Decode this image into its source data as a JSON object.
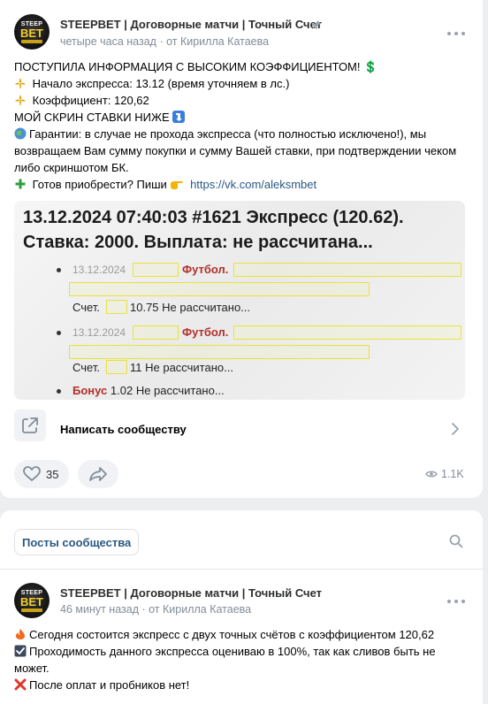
{
  "post1": {
    "avatar": {
      "top": "STEEP",
      "mid": "BET"
    },
    "author": "STEEPBET | Договорные матчи | Точный Счет",
    "time": "четыре часа назад",
    "from": "от Кирилла Катаева",
    "lines": {
      "l1": "ПОСТУПИЛА ИНФОРМАЦИЯ С ВЫСОКИМ КОЭФФИЦИЕНТОМ!",
      "l1_emoji": "💲",
      "l2": "Начало экспресса: 13.12 (время уточняем в лс.)",
      "l3": "Коэффициент: 120,62",
      "l4": "МОЙ СКРИН СТАВКИ НИЖЕ",
      "l5": "Гарантии: в случае не прохода экспресса (что полностью исключено!), мы возвращаем Вам сумму покупки и сумму Вашей ставки, при подтверждении чеком либо скриншотом БК.",
      "l6": "Готов приобрести? Пиши",
      "l6_link": "https://vk.com/aleksmbet"
    },
    "screenshot": {
      "heading1": "13.12.2024 07:40:03 #1621 Экспресс (120.62).",
      "heading2": "Ставка: 2000. Выплата: не рассчитана...",
      "row1_date": "13.12.2024",
      "row1_sport": "Футбол.",
      "row1_score": "Счет.",
      "row1_result": "10.75 Не рассчитано...",
      "row2_date": "13.12.2024",
      "row2_sport": "Футбол.",
      "row2_score": "Счет.",
      "row2_result": "11 Не рассчитано...",
      "bonus_label": "Бонус",
      "bonus_result": "1.02 Не рассчитано..."
    },
    "write_label": "Написать сообществу",
    "likes": "35",
    "views": "1.1K"
  },
  "community_tab": "Посты сообщества",
  "post2": {
    "avatar": {
      "top": "STEEP",
      "mid": "BET"
    },
    "author": "STEEPBET | Договорные матчи | Точный Счет",
    "time": "46 минут назад",
    "from": "от Кирилла Катаева",
    "lines": {
      "l1": "Сегодня состоится экспресс с двух точных счётов с коэффициентом 120,62",
      "l2": "Проходимость данного экспресса оцениваю в 100%, так как сливов быть не может.",
      "l3": "После оплат и пробников нет!"
    }
  },
  "colors": {
    "link": "#2a5885",
    "meta": "#818c99",
    "accent": "#f2cf2b"
  }
}
